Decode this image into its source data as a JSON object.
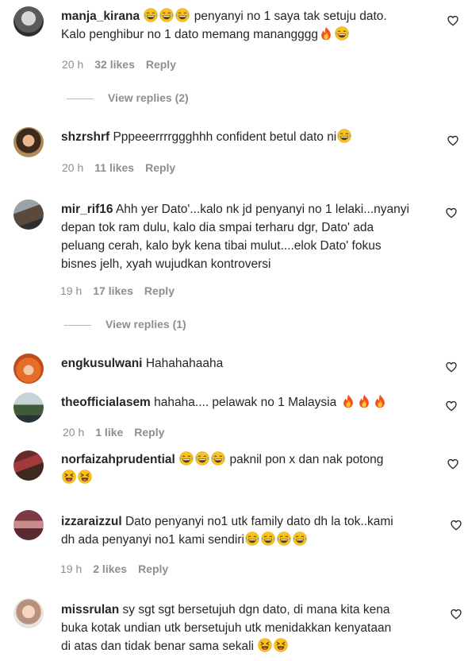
{
  "comments": [
    {
      "username": "manja_kirana",
      "pre_emoji": [
        "laugh",
        "laugh",
        "laugh"
      ],
      "text": " penyanyi no 1 saya tak setuju dato.",
      "line2": "Kalo penghibur no 1 dato memang manangggg",
      "post_emoji": [
        "fire",
        "laugh"
      ],
      "time": "20 h",
      "likes": "32 likes",
      "reply": "Reply",
      "view_replies": "View replies (2)"
    },
    {
      "username": "shzrshrf",
      "text": "Pppeeerrrrggghhh confident betul dato ni",
      "post_emoji": [
        "laugh"
      ],
      "time": "20 h",
      "likes": "11 likes",
      "reply": "Reply"
    },
    {
      "username": "mir_rif16",
      "text": "Ahh yer Dato'...kalo nk jd penyanyi no 1 lelaki...nyanyi",
      "lines": [
        "depan tok ram dulu, kalo dia smpai terharu dgr, Dato' ada",
        "peluang cerah, kalo byk kena tibai mulut....elok Dato' fokus",
        "bisnes jelh, xyah wujudkan kontroversi"
      ],
      "time": "19 h",
      "likes": "17 likes",
      "reply": "Reply",
      "view_replies": "View replies (1)"
    },
    {
      "username": "engkusulwani",
      "text": "Hahahahaaha"
    },
    {
      "username": "theofficialasem",
      "text": "hahaha.... pelawak no 1 Malaysia ",
      "post_emoji": [
        "fire",
        "fire",
        "fire"
      ],
      "time": "20 h",
      "likes": "1 like",
      "reply": "Reply"
    },
    {
      "username": "norfaizahprudential",
      "pre_emoji": [
        "laugh",
        "laugh",
        "laugh"
      ],
      "text": " paknil pon x dan nak potong",
      "line2_emoji": [
        "squint",
        "squint"
      ]
    },
    {
      "username": "izzaraizzul",
      "text": "Dato penyanyi no1 utk family dato dh la tok..kami",
      "line2": "dh ada penyanyi no1 kami sendiri",
      "post_emoji": [
        "laugh",
        "laugh",
        "laugh",
        "laugh"
      ],
      "time": "19 h",
      "likes": "2 likes",
      "reply": "Reply"
    },
    {
      "username": "missrulan",
      "text": "sy sgt sgt bersetujuh dgn dato, di mana kita kena",
      "lines": [
        "buka kotak undian utk bersetujuh utk menidakkan kenyataan"
      ],
      "line_last": "di atas dan tidak benar sama sekali ",
      "post_emoji": [
        "squint",
        "squint"
      ]
    }
  ],
  "colors": {
    "muted": "#8e8e8e",
    "text": "#262626",
    "fire": "#f4511e",
    "emoji": "#fcc21b"
  }
}
